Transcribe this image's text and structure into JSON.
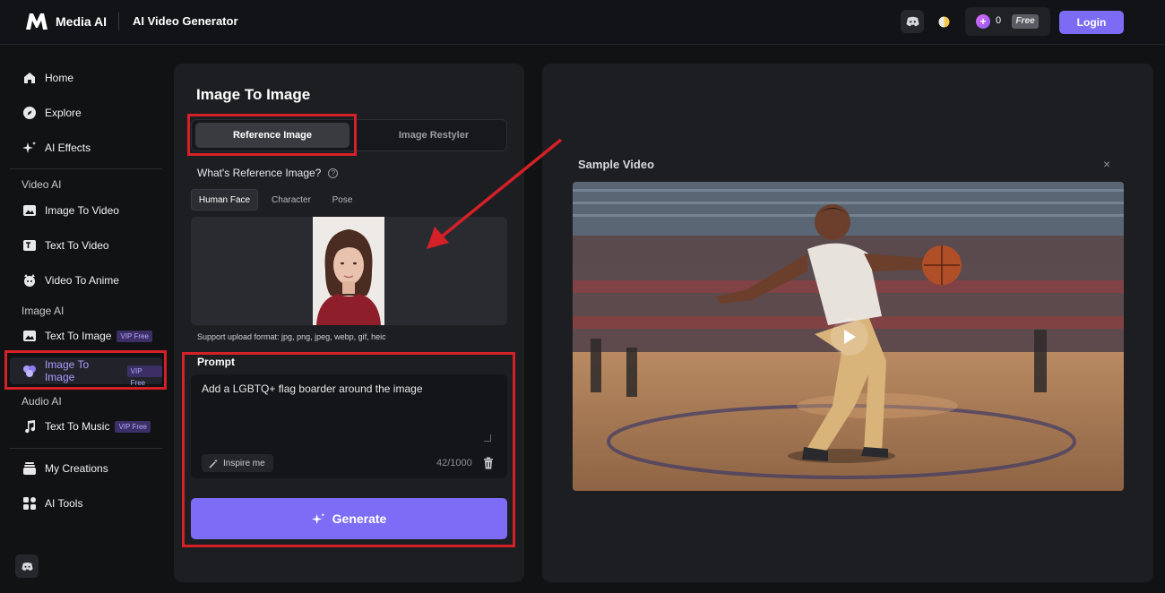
{
  "header": {
    "brand": "Media AI",
    "page_title": "AI Video Generator",
    "credits_count": "0",
    "credits_badge": "Free",
    "login_label": "Login"
  },
  "sidebar": {
    "items": [
      {
        "label": "Home"
      },
      {
        "label": "Explore"
      },
      {
        "label": "AI Effects"
      }
    ],
    "video_section": "Video AI",
    "video_items": [
      {
        "label": "Image To Video"
      },
      {
        "label": "Text To Video"
      },
      {
        "label": "Video To Anime"
      }
    ],
    "image_section": "Image AI",
    "image_items": [
      {
        "label": "Text To Image",
        "badge": "VIP Free"
      },
      {
        "label": "Image To Image",
        "badge": "VIP Free"
      }
    ],
    "audio_section": "Audio AI",
    "audio_items": [
      {
        "label": "Text To Music",
        "badge": "VIP Free"
      }
    ],
    "bottom_items": [
      {
        "label": "My Creations"
      },
      {
        "label": "AI Tools"
      }
    ]
  },
  "main": {
    "title": "Image To Image",
    "tabs": [
      {
        "label": "Reference Image"
      },
      {
        "label": "Image Restyler"
      }
    ],
    "reference_question": "What's Reference Image?",
    "subtabs": [
      {
        "label": "Human Face"
      },
      {
        "label": "Character"
      },
      {
        "label": "Pose"
      }
    ],
    "support_text": "Support upload format: jpg, png, jpeg, webp, gif, heic",
    "prompt_label": "Prompt",
    "prompt_value": "Add a LGBTQ+ flag boarder around the image",
    "inspire_label": "Inspire me",
    "char_counter": "42/1000",
    "generate_label": "Generate"
  },
  "preview": {
    "title": "Sample Video",
    "close_symbol": "×"
  },
  "colors": {
    "accent": "#7c6cf5",
    "annotation": "#d42027",
    "background": "#111214",
    "panel": "#1d1e22"
  }
}
